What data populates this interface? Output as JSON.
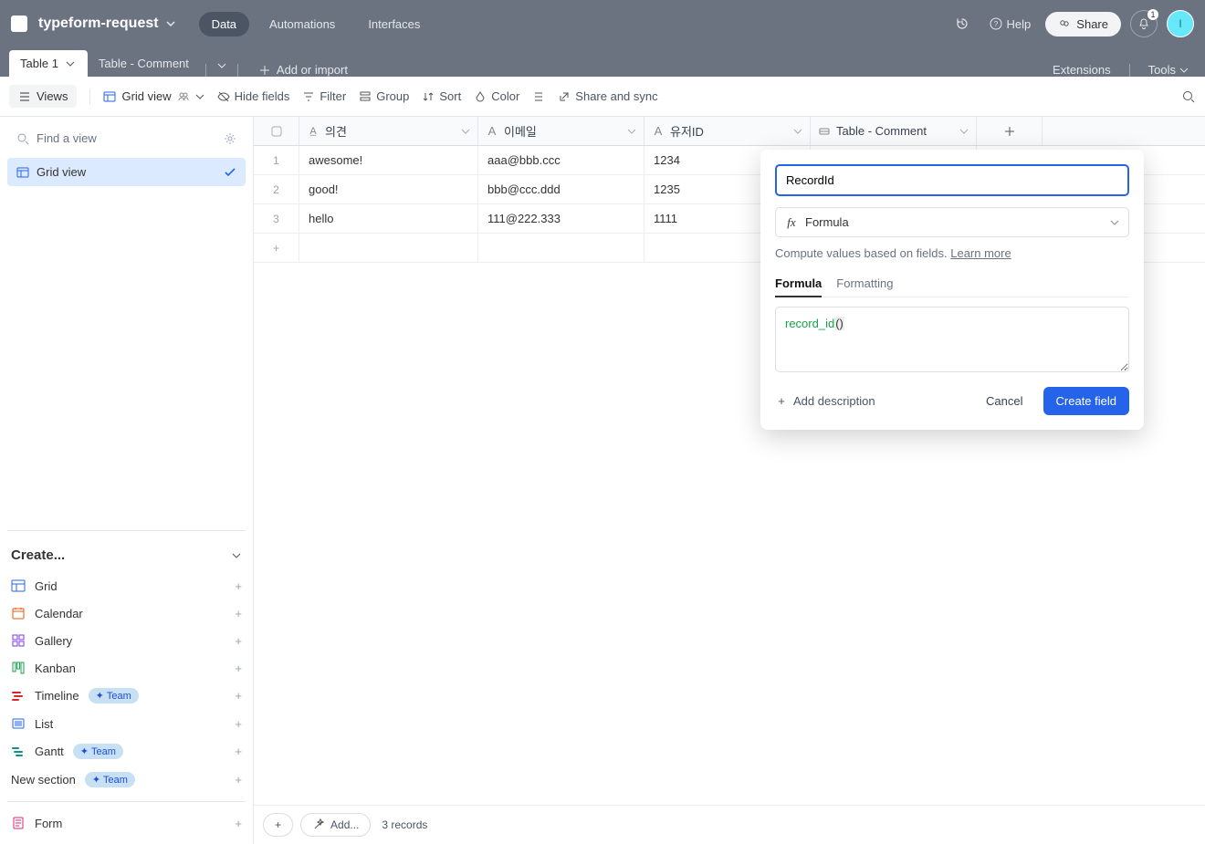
{
  "header": {
    "base_name": "typeform-request",
    "tabs": {
      "data": "Data",
      "automations": "Automations",
      "interfaces": "Interfaces"
    },
    "help": "Help",
    "share": "Share",
    "notification_count": "1",
    "avatar_letter": "I"
  },
  "tables": {
    "active": "Table 1",
    "other": "Table - Comment",
    "add_import": "Add or import",
    "extensions": "Extensions",
    "tools": "Tools"
  },
  "viewbar": {
    "views": "Views",
    "view_name": "Grid view",
    "hide_fields": "Hide fields",
    "filter": "Filter",
    "group": "Group",
    "sort": "Sort",
    "color": "Color",
    "share_sync": "Share and sync"
  },
  "sidebar": {
    "find": "Find a view",
    "view_item": "Grid view",
    "create_header": "Create...",
    "items": [
      {
        "label": "Grid",
        "badge": null
      },
      {
        "label": "Calendar",
        "badge": null
      },
      {
        "label": "Gallery",
        "badge": null
      },
      {
        "label": "Kanban",
        "badge": null
      },
      {
        "label": "Timeline",
        "badge": "Team"
      },
      {
        "label": "List",
        "badge": null
      },
      {
        "label": "Gantt",
        "badge": "Team"
      }
    ],
    "new_section": {
      "label": "New section",
      "badge": "Team"
    },
    "form": "Form"
  },
  "columns": {
    "a": "의견",
    "b": "이메일",
    "c": "유저ID",
    "d": "Table - Comment"
  },
  "rows": [
    {
      "n": "1",
      "a": "awesome!",
      "b": "aaa@bbb.ccc",
      "c": "1234"
    },
    {
      "n": "2",
      "a": "good!",
      "b": "bbb@ccc.ddd",
      "c": "1235"
    },
    {
      "n": "3",
      "a": "hello",
      "b": "111@222.333",
      "c": "1111"
    }
  ],
  "footer": {
    "add": "Add...",
    "records": "3 records"
  },
  "popup": {
    "name_value": "RecordId",
    "type_label": "Formula",
    "helper_text": "Compute values based on fields. ",
    "learn_more": "Learn more",
    "tab_formula": "Formula",
    "tab_formatting": "Formatting",
    "formula_fn": "record_id",
    "formula_parens": "()",
    "add_description": "Add description",
    "cancel": "Cancel",
    "create": "Create field"
  }
}
